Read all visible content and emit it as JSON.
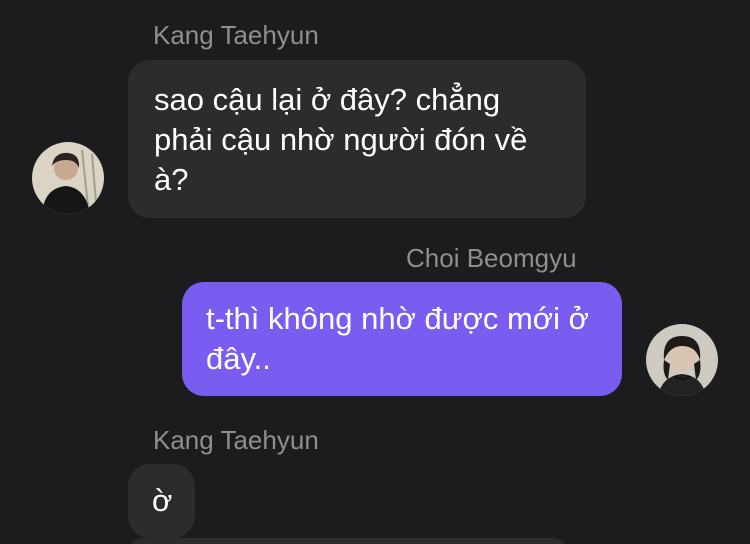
{
  "messages": [
    {
      "sender": "Kang Taehyun",
      "text": "sao cậu lại ở đây? chẳng phải cậu nhờ người đón về à?",
      "direction": "received",
      "avatar_icon": "user-avatar-taehyun"
    },
    {
      "sender": "Choi Beomgyu",
      "text": "t-thì không nhờ được mới ở đây..",
      "direction": "sent",
      "avatar_icon": "user-avatar-beomgyu"
    },
    {
      "sender": "Kang Taehyun",
      "text": "ờ",
      "direction": "received"
    }
  ],
  "colors": {
    "background": "#1c1c1e",
    "received_bubble": "#2c2c2e",
    "sent_bubble": "#7a5cf0",
    "sender_name": "#8e8e93",
    "message_text": "#ffffff"
  }
}
